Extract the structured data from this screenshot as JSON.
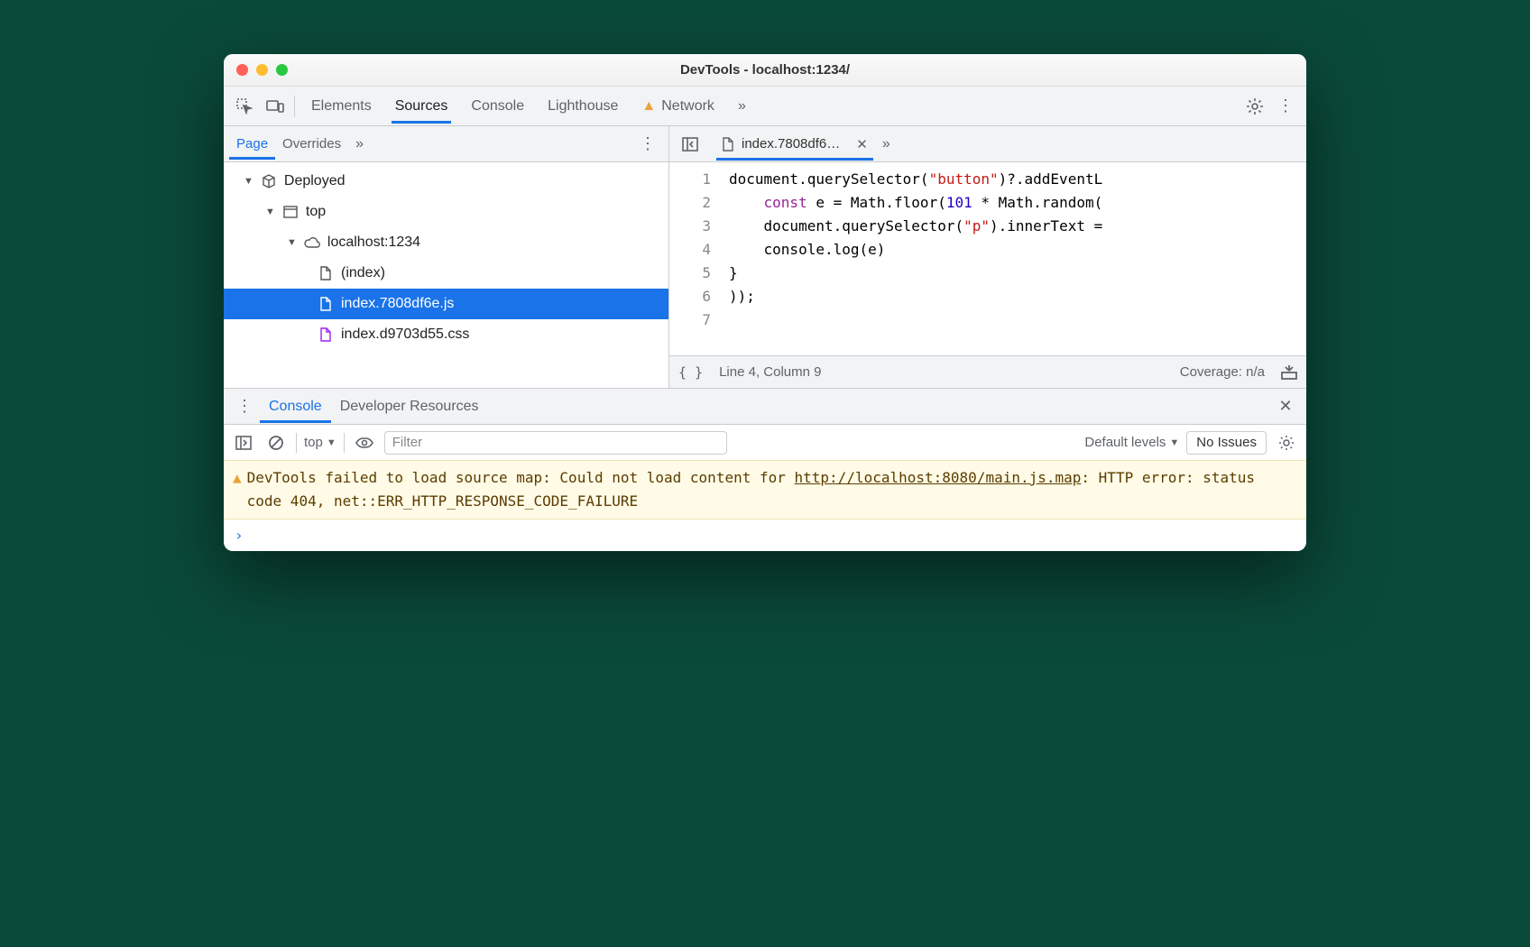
{
  "window": {
    "title": "DevTools - localhost:1234/"
  },
  "toolbar": {
    "tabs": [
      "Elements",
      "Sources",
      "Console",
      "Lighthouse",
      "Network"
    ],
    "active": "Sources"
  },
  "nav": {
    "tabs": [
      "Page",
      "Overrides"
    ],
    "active": "Page",
    "tree": {
      "root": "Deployed",
      "top": "top",
      "host": "localhost:1234",
      "files": [
        {
          "name": "(index)",
          "type": "file"
        },
        {
          "name": "index.7808df6e.js",
          "type": "js",
          "selected": true
        },
        {
          "name": "index.d9703d55.css",
          "type": "css"
        }
      ]
    }
  },
  "source": {
    "tab": "index.7808df6…",
    "code": [
      {
        "n": 1,
        "segments": [
          {
            "t": "document.querySelector("
          },
          {
            "t": "\"button\"",
            "c": "s-str"
          },
          {
            "t": ")?.addEventL"
          }
        ]
      },
      {
        "n": 2,
        "segments": [
          {
            "t": "    "
          },
          {
            "t": "const",
            "c": "s-kw"
          },
          {
            "t": " e = Math.floor("
          },
          {
            "t": "101",
            "c": "s-num"
          },
          {
            "t": " * Math.random("
          }
        ]
      },
      {
        "n": 3,
        "segments": [
          {
            "t": "    document.querySelector("
          },
          {
            "t": "\"p\"",
            "c": "s-str"
          },
          {
            "t": ").innerText ="
          }
        ]
      },
      {
        "n": 4,
        "segments": [
          {
            "t": "    console.log(e)"
          }
        ]
      },
      {
        "n": 5,
        "segments": [
          {
            "t": "}"
          }
        ]
      },
      {
        "n": 6,
        "segments": [
          {
            "t": "));"
          }
        ]
      },
      {
        "n": 7,
        "segments": [
          {
            "t": ""
          }
        ]
      }
    ],
    "status": {
      "cursor": "Line 4, Column 9",
      "coverage": "Coverage: n/a"
    }
  },
  "drawer": {
    "tabs": [
      "Console",
      "Developer Resources"
    ],
    "active": "Console"
  },
  "console": {
    "context": "top",
    "filter_placeholder": "Filter",
    "levels": "Default levels",
    "issues": "No Issues",
    "warning": {
      "prefix": "DevTools failed to load source map: Could not load content for ",
      "link": "http://localhost:8080/main.js.map",
      "suffix": ": HTTP error: status code 404, net::ERR_HTTP_RESPONSE_CODE_FAILURE"
    }
  }
}
